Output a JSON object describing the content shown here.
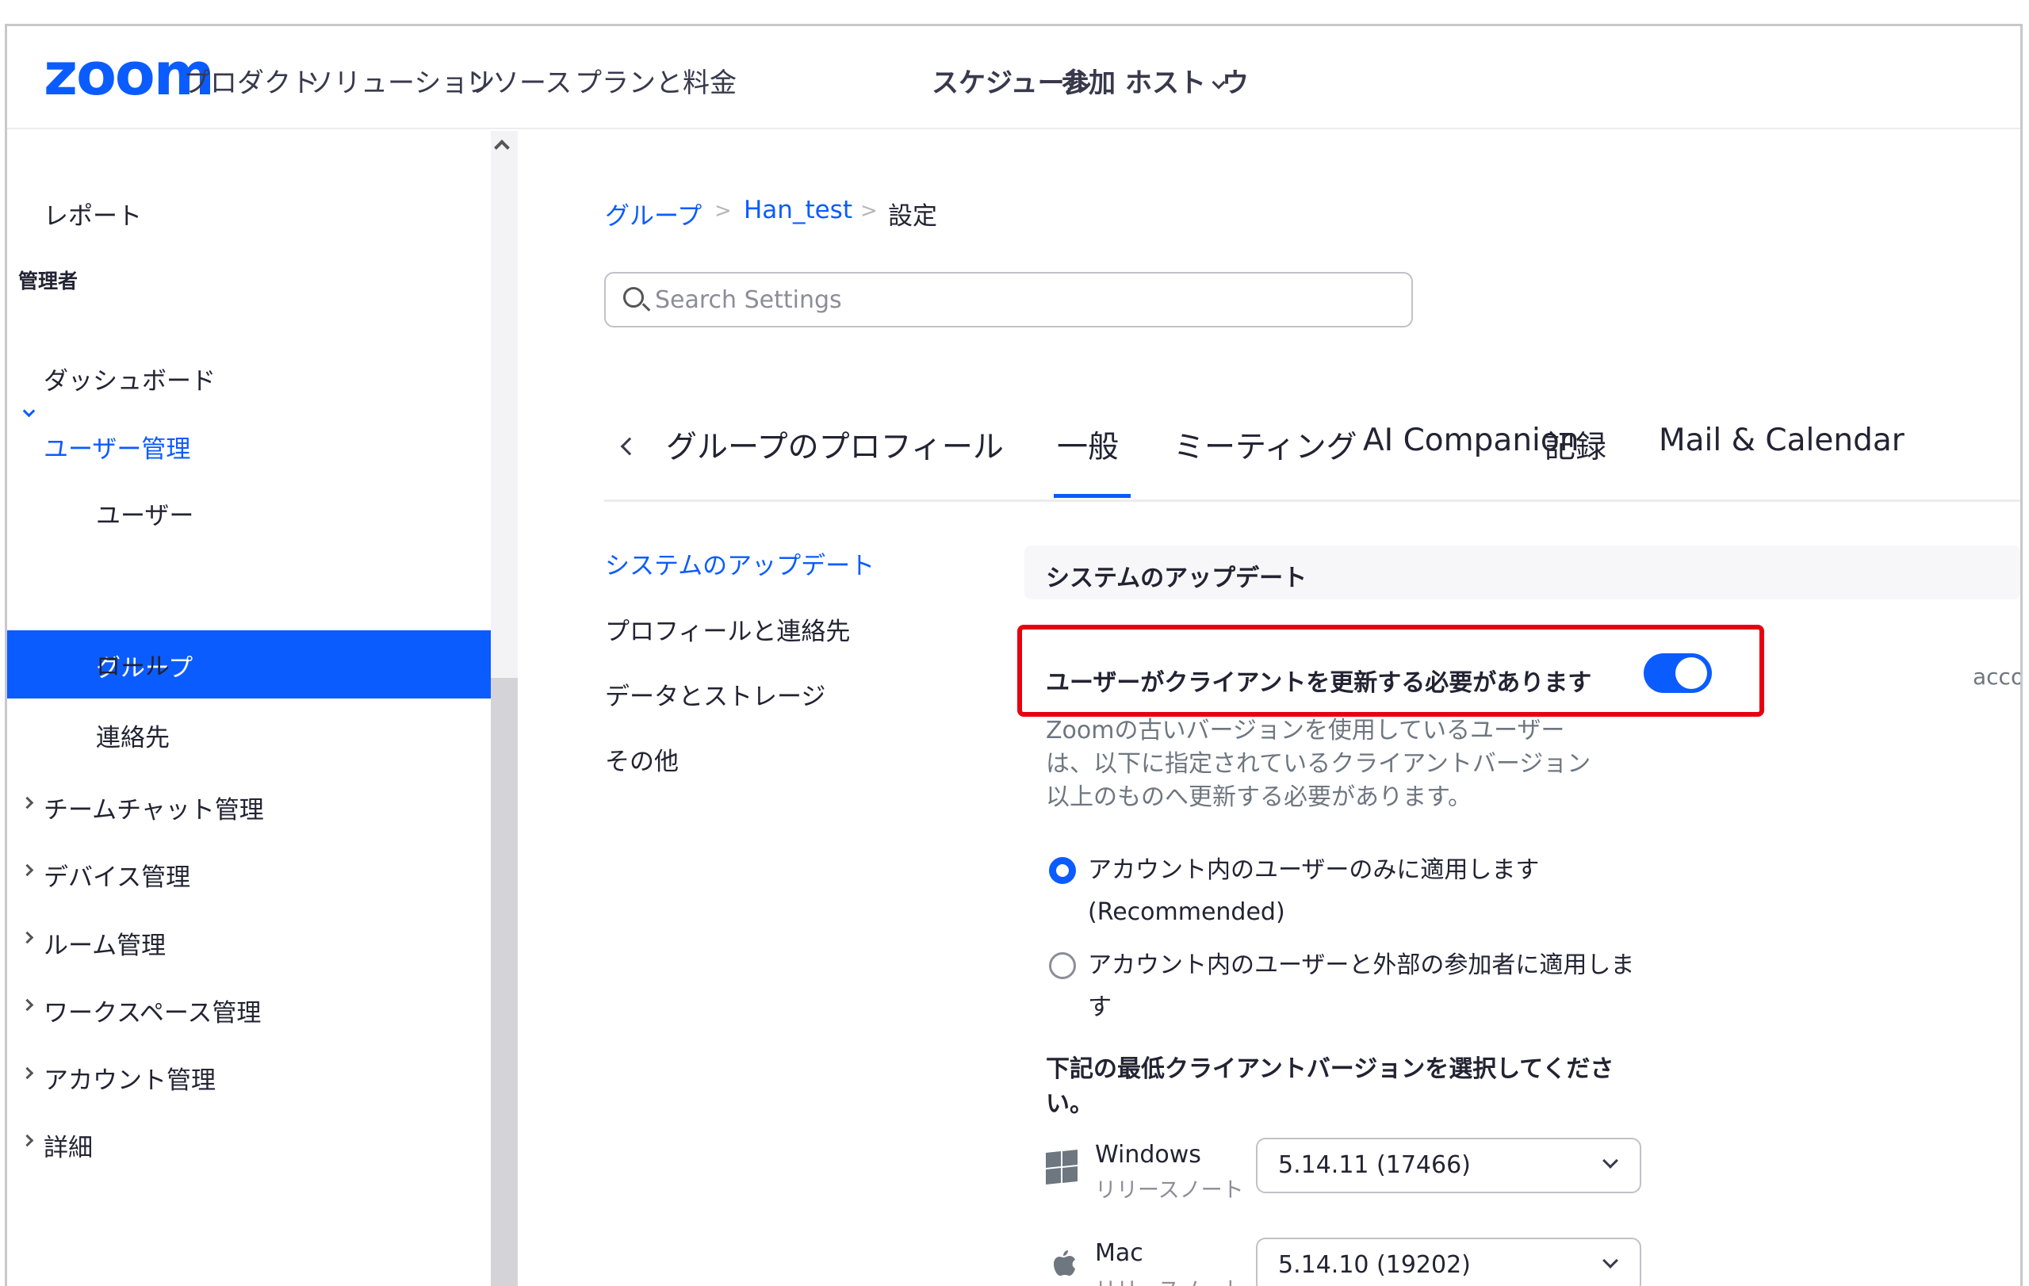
{
  "topnav": {
    "logo": "zoom",
    "items": [
      "プロダクト",
      "ソリューション",
      "リソース",
      "プランと料金"
    ],
    "right_items": [
      "スケジュール",
      "参加",
      "ホスト",
      "ウ"
    ]
  },
  "sidebar": {
    "report": "レポート",
    "admin_section": "管理者",
    "dashboard": "ダッシュボード",
    "user_mgmt": "ユーザー管理",
    "users": "ユーザー",
    "groups": "グループ",
    "roles": "ロール",
    "contacts": "連絡先",
    "team_chat": "チームチャット管理",
    "device": "デバイス管理",
    "room": "ルーム管理",
    "workspace": "ワークスペース管理",
    "account": "アカウント管理",
    "advanced": "詳細"
  },
  "breadcrumb": {
    "groups": "グループ",
    "group_name": "Han_test",
    "current": "設定",
    "sep": ">"
  },
  "search": {
    "placeholder": "Search Settings"
  },
  "tabs": [
    "グループのプロフィール",
    "一般",
    "ミーティング",
    "AI Companion",
    "記録",
    "Mail & Calendar"
  ],
  "subnav": [
    "システムのアップデート",
    "プロフィールと連絡先",
    "データとストレージ",
    "その他"
  ],
  "section": {
    "title": "システムのアップデート",
    "setting_label": "ユーザーがクライアントを更新する必要があります",
    "toggle_on": true,
    "side_text": "accou",
    "description_lines": [
      "Zoomの古いバージョンを使用しているユーザー",
      "は、以下に指定されているクライアントバージョン",
      "以上のものへ更新する必要があります。"
    ],
    "radio1_line1": "アカウント内のユーザーのみに適用します",
    "radio1_line2": "(Recommended)",
    "radio2_line1": "アカウント内のユーザーと外部の参加者に適用しま",
    "radio2_line2": "す",
    "min_version_title_line1": "下記の最低クライアントバージョンを選択してくださ",
    "min_version_title_line2": "い。",
    "windows_label": "Windows",
    "windows_sub": "リリースノート",
    "windows_version": "5.14.11 (17466)",
    "mac_label": "Mac",
    "mac_sub": "リリースノート",
    "mac_version": "5.14.10 (19202)"
  },
  "colors": {
    "brand": "#0b5cff",
    "highlight": "#e8000f"
  }
}
